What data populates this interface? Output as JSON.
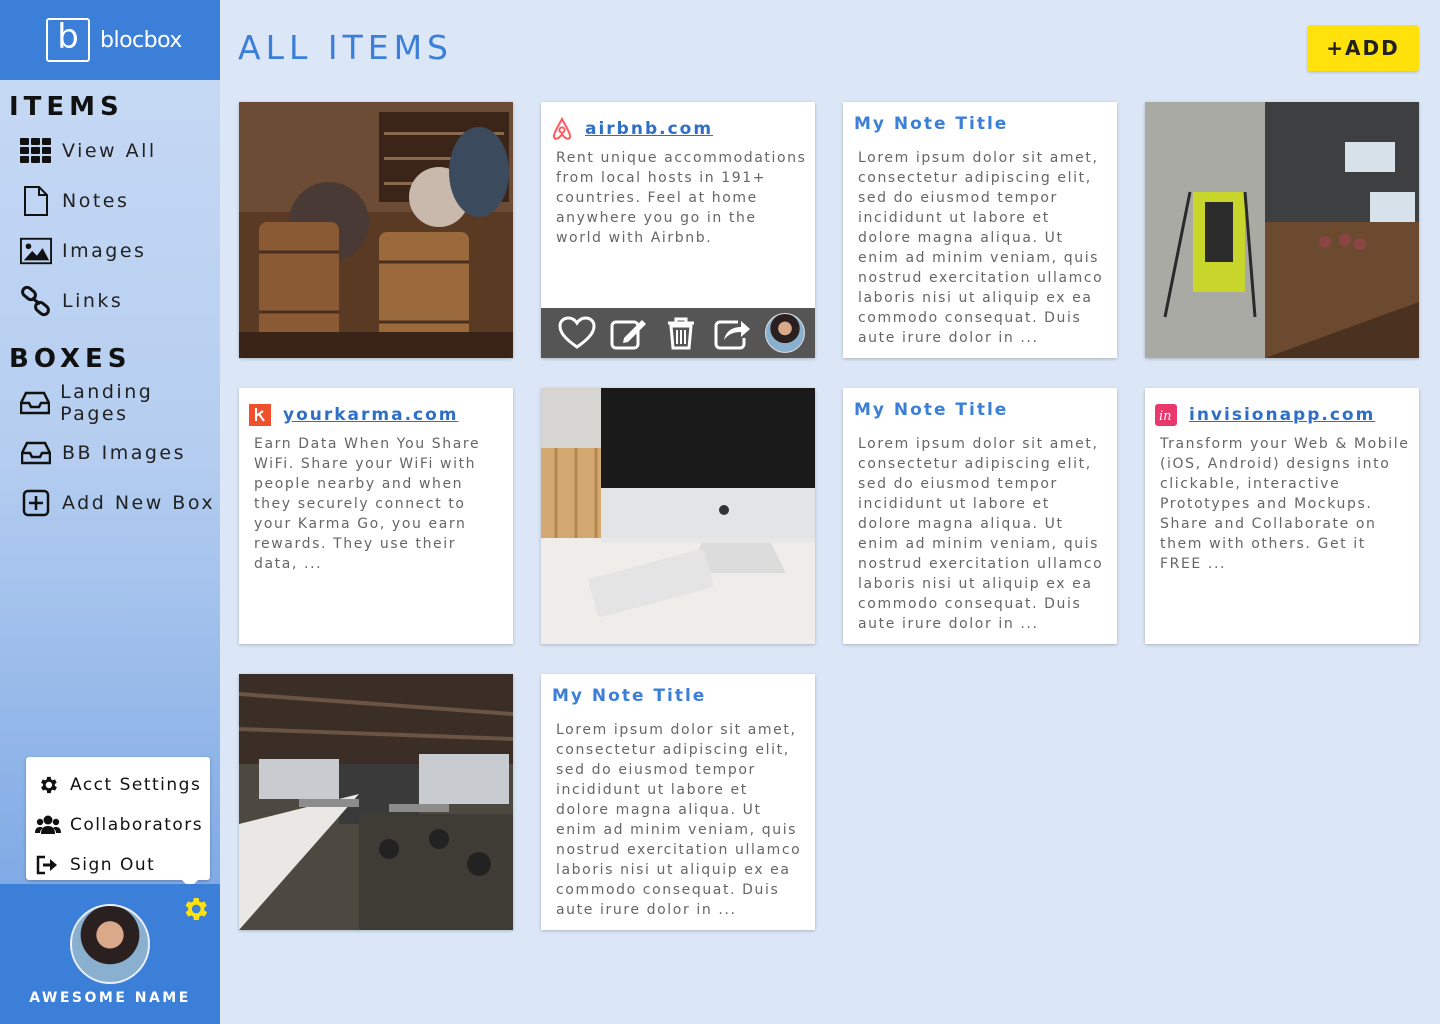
{
  "app": {
    "brand_letter": "b",
    "brand_name": "blocbox"
  },
  "sidebar": {
    "items_title": "ITEMS",
    "items": [
      {
        "label": "View All",
        "icon": "grid-icon"
      },
      {
        "label": "Notes",
        "icon": "note-icon"
      },
      {
        "label": "Images",
        "icon": "image-icon"
      },
      {
        "label": "Links",
        "icon": "link-icon"
      }
    ],
    "boxes_title": "BOXES",
    "boxes": [
      {
        "label": "Landing Pages",
        "icon": "inbox-icon"
      },
      {
        "label": "BB Images",
        "icon": "inbox-icon"
      },
      {
        "label": "Add New Box",
        "icon": "plus-square-icon"
      }
    ]
  },
  "account_menu": {
    "items": [
      {
        "label": "Acct Settings",
        "icon": "gear-icon"
      },
      {
        "label": "Collaborators",
        "icon": "users-icon"
      },
      {
        "label": "Sign Out",
        "icon": "sign-out-icon"
      }
    ]
  },
  "profile": {
    "name": "AWESOME NAME"
  },
  "main": {
    "title": "ALL ITEMS",
    "add_label": "+ADD",
    "cards": [
      {
        "type": "image",
        "subject": "wine bar with barrels"
      },
      {
        "type": "link",
        "site": "airbnb.com",
        "text": "Rent unique accommodations from local hosts in 191+ countries. Feel at home anywhere you go in the world with Airbnb."
      },
      {
        "type": "note",
        "title": "My Note Title",
        "text": "Lorem ipsum dolor sit amet, consectetur adipiscing elit, sed do eiusmod tempor incididunt ut labore et dolore magna aliqua. Ut enim ad minim veniam, quis nostrud exercitation ullamco laboris nisi ut aliquip ex ea commodo consequat. Duis aute irure dolor in ..."
      },
      {
        "type": "image",
        "subject": "office hallway with poster"
      },
      {
        "type": "link",
        "site": "yourkarma.com",
        "text": "Earn Data When You Share WiFi. Share your WiFi with people nearby and when they securely connect to your Karma Go, you earn rewards. They use their data, ..."
      },
      {
        "type": "image",
        "subject": "desk with computer and keyboard"
      },
      {
        "type": "note",
        "title": "My Note Title",
        "text": "Lorem ipsum dolor sit amet, consectetur adipiscing elit, sed do eiusmod tempor incididunt ut labore et dolore magna aliqua. Ut enim ad minim veniam, quis nostrud exercitation ullamco laboris nisi ut aliquip ex ea commodo consequat. Duis aute irure dolor in ..."
      },
      {
        "type": "link",
        "site": "invisionapp.com",
        "text": "Transform your Web & Mobile (iOS, Android) designs into clickable, interactive Prototypes and Mockups. Share and Collaborate on them with others. Get it FREE ..."
      },
      {
        "type": "image",
        "subject": "open office interior"
      },
      {
        "type": "note",
        "title": "My Note Title",
        "text": "Lorem ipsum dolor sit amet, consectetur adipiscing elit, sed do eiusmod tempor incididunt ut labore et dolore magna aliqua. Ut enim ad minim veniam, quis nostrud exercitation ullamco laboris nisi ut aliquip ex ea commodo consequat. Duis aute irure dolor in ..."
      }
    ],
    "hover_actions": [
      "heart-icon",
      "edit-icon",
      "trash-icon",
      "share-icon",
      "collaborator-avatar"
    ]
  },
  "colors": {
    "accent": "#3b7fd9",
    "add_button": "#ffe20c",
    "background": "#dbe6f6",
    "actions_bar": "#555555"
  }
}
